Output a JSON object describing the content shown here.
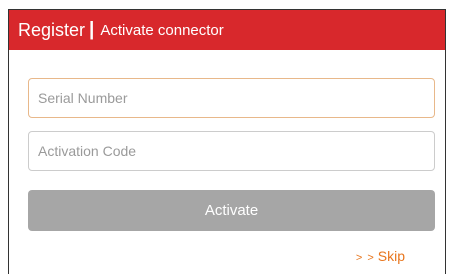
{
  "header": {
    "title": "Register",
    "separator": "|",
    "subtitle": "Activate connector"
  },
  "form": {
    "serial_placeholder": "Serial Number",
    "activation_placeholder": "Activation Code",
    "activate_label": "Activate",
    "skip_arrows": "> >",
    "skip_label": "Skip"
  },
  "colors": {
    "header_bg": "#d8282c",
    "button_bg": "#a6a6a6",
    "link": "#e8761e",
    "focus_border": "#e8b88a"
  }
}
